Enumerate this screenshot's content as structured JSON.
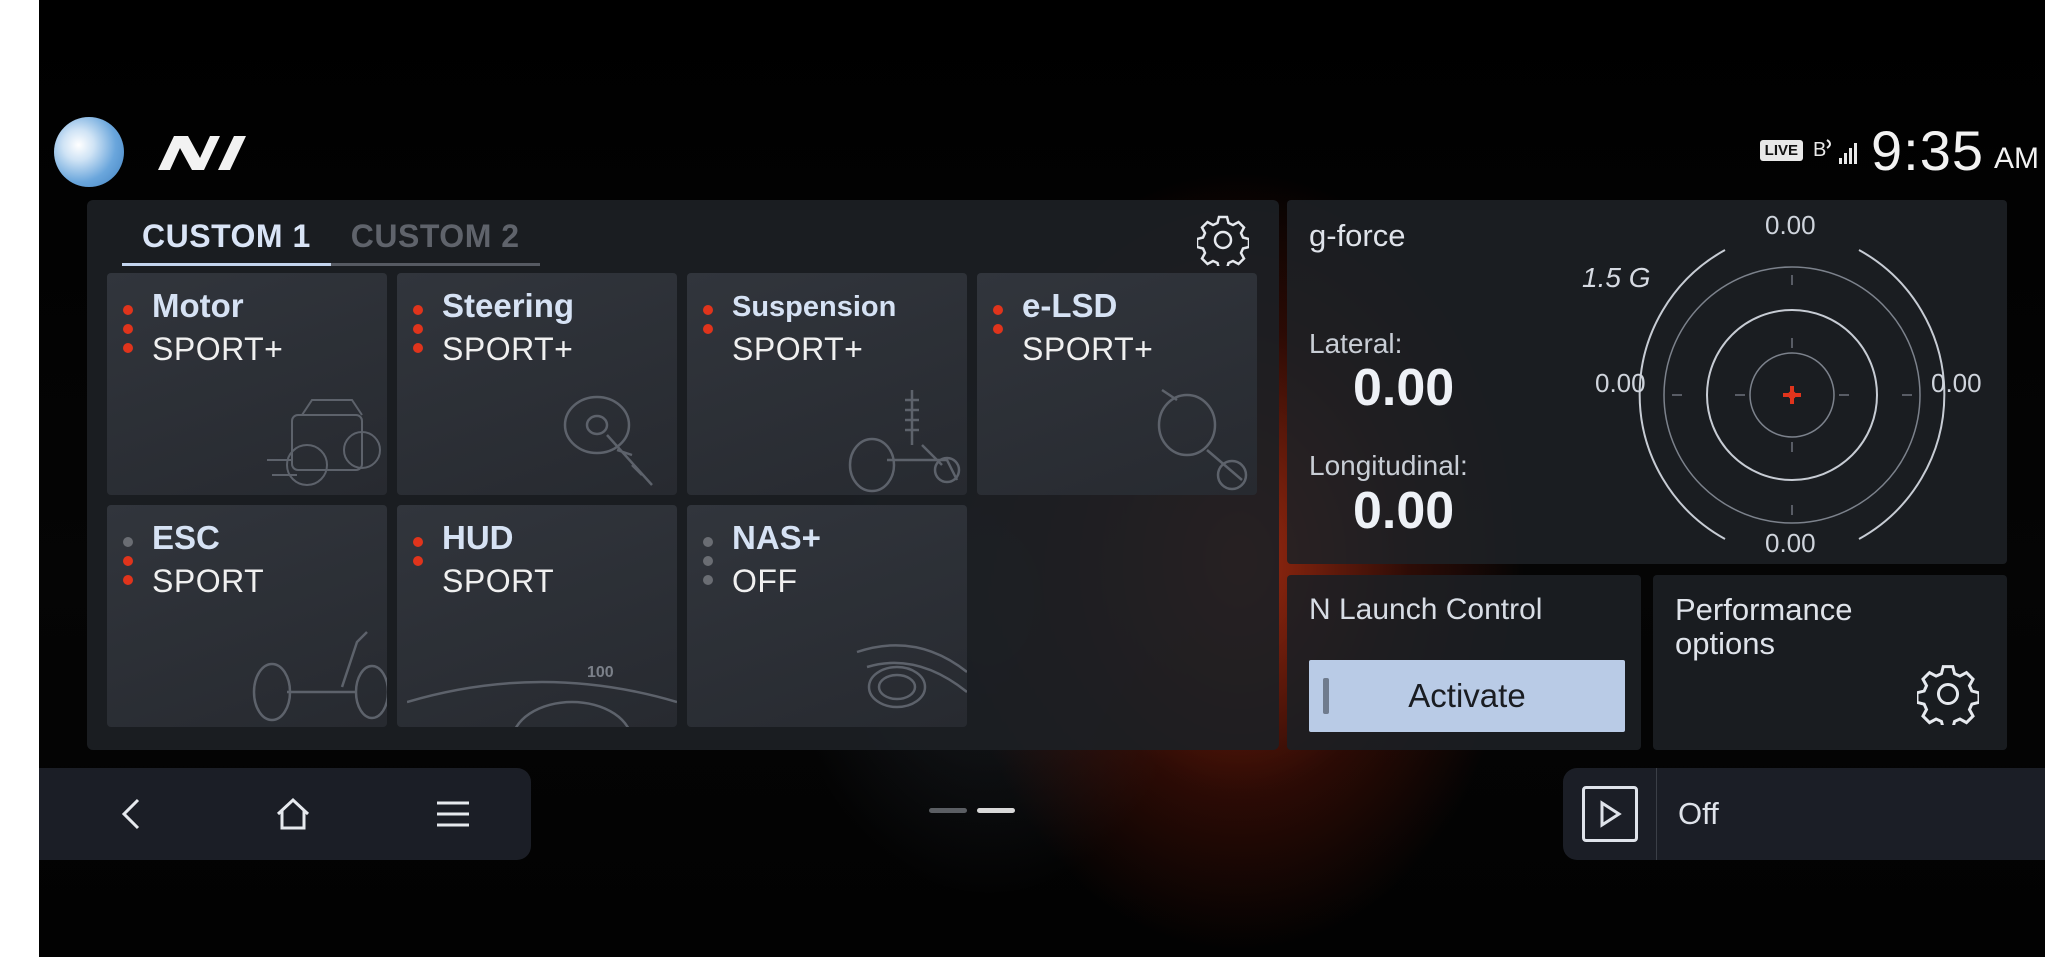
{
  "status": {
    "live_badge": "LIVE",
    "clock": "9:35",
    "ampm": "AM"
  },
  "tabs": [
    {
      "label": "CUSTOM 1",
      "active": true
    },
    {
      "label": "CUSTOM 2",
      "active": false
    }
  ],
  "modes": [
    {
      "name": "Motor",
      "value": "SPORT+",
      "level": 3,
      "levels": 3
    },
    {
      "name": "Steering",
      "value": "SPORT+",
      "level": 3,
      "levels": 3
    },
    {
      "name": "Suspension",
      "value": "SPORT+",
      "level": 2,
      "levels": 2
    },
    {
      "name": "e-LSD",
      "value": "SPORT+",
      "level": 2,
      "levels": 2
    },
    {
      "name": "ESC",
      "value": "SPORT",
      "level": 2,
      "levels": 3
    },
    {
      "name": "HUD",
      "value": "SPORT",
      "level": 2,
      "levels": 2
    },
    {
      "name": "NAS+",
      "value": "OFF",
      "level": 0,
      "levels": 3
    }
  ],
  "hud_speed": "100",
  "gforce": {
    "title": "g-force",
    "lateral_label": "Lateral:",
    "lateral_value": "0.00",
    "longitudinal_label": "Longitudinal:",
    "longitudinal_value": "0.00",
    "scale_label": "1.5 G",
    "top": "0.00",
    "left": "0.00",
    "right": "0.00",
    "bottom": "0.00"
  },
  "launch": {
    "title": "N Launch Control",
    "button": "Activate"
  },
  "performance": {
    "title": "Performance options"
  },
  "media": {
    "status": "Off"
  },
  "colors": {
    "accent_red": "#e0341c",
    "button_blue": "#b9cbe6",
    "panel": "#1c1f24"
  }
}
